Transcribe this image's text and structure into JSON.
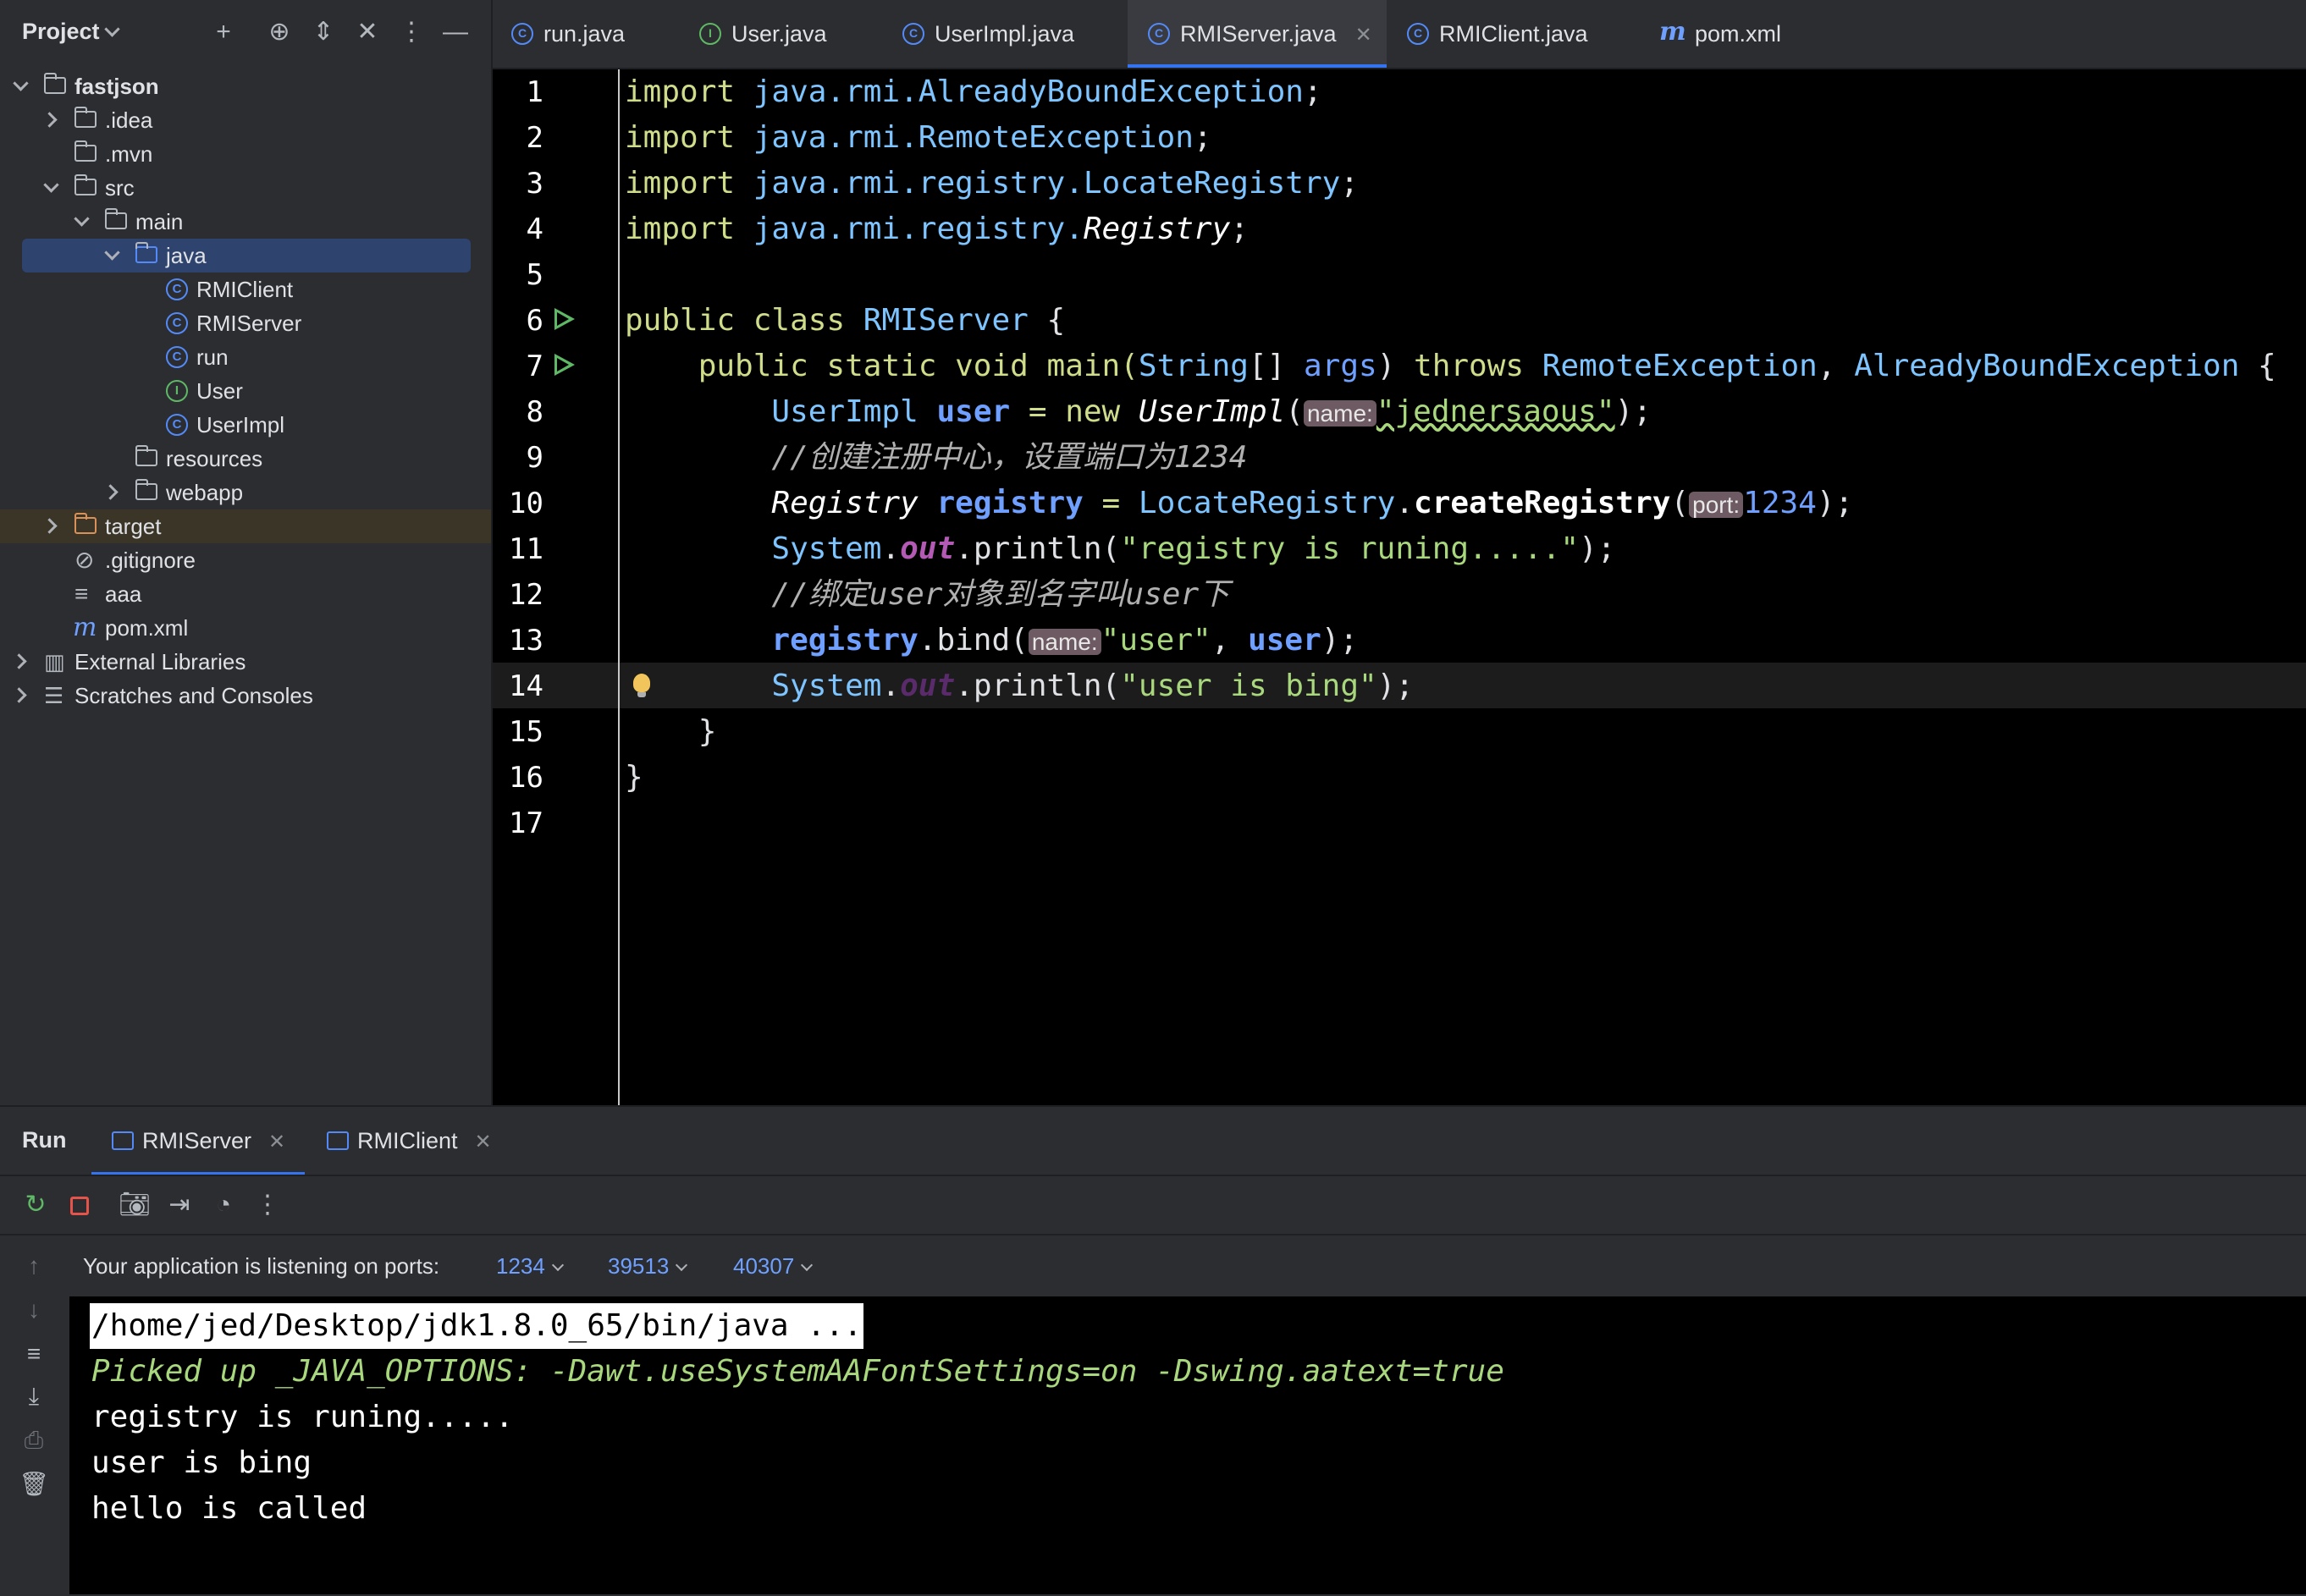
{
  "project": {
    "title": "Project",
    "tree": [
      {
        "label": "fastjson",
        "bold": true
      },
      {
        "label": ".idea"
      },
      {
        "label": ".mvn"
      },
      {
        "label": "src"
      },
      {
        "label": "main"
      },
      {
        "label": "java"
      },
      {
        "label": "RMIClient"
      },
      {
        "label": "RMIServer"
      },
      {
        "label": "run"
      },
      {
        "label": "User"
      },
      {
        "label": "UserImpl"
      },
      {
        "label": "resources"
      },
      {
        "label": "webapp"
      },
      {
        "label": "target"
      },
      {
        "label": ".gitignore"
      },
      {
        "label": "aaa"
      },
      {
        "label": "pom.xml"
      },
      {
        "label": "External Libraries"
      },
      {
        "label": "Scratches and Consoles"
      }
    ]
  },
  "tabs": [
    {
      "label": "run.java",
      "icon": "class-icon"
    },
    {
      "label": "User.java",
      "icon": "interface-icon"
    },
    {
      "label": "UserImpl.java",
      "icon": "class-icon"
    },
    {
      "label": "RMIServer.java",
      "icon": "class-icon",
      "active": true
    },
    {
      "label": "RMIClient.java",
      "icon": "class-icon"
    },
    {
      "label": "pom.xml",
      "icon": "maven-icon"
    }
  ],
  "editor": {
    "line_numbers": [
      "1",
      "2",
      "3",
      "4",
      "5",
      "6",
      "7",
      "8",
      "9",
      "10",
      "11",
      "12",
      "13",
      "14",
      "15",
      "16",
      "17"
    ],
    "tokens": {
      "import": "import",
      "l1_pkg": "java.rmi.AlreadyBoundException",
      "l2_pkg": "java.rmi.RemoteException",
      "l3_pkg": "java.rmi.registry.LocateRegistry",
      "l4_pkg": "java.rmi.registry.",
      "l4_cls": "Registry",
      "semi": ";",
      "public_class": "public class ",
      "RMIServer": "RMIServer",
      "brace_open": " {",
      "l7_kw": "public static void ",
      "main": "main(",
      "String": "String",
      "arr": "[] ",
      "args": "args",
      "close_paren": ") ",
      "throws": "throws ",
      "RemoteException": "RemoteException",
      "comma": ", ",
      "AlreadyBoundException": "AlreadyBoundException",
      "UserImpl": "UserImpl",
      "user": "user",
      "eq": " = ",
      "new": "new ",
      "UserImplCtor": "UserImpl",
      "lparen": "(",
      "hint_name": "name:",
      "str_jed": "\"jednersaous\"",
      "rparen_semi": ");",
      "comment1": "//创建注册中心，设置端口为1234",
      "Registry": "Registry",
      "registry": "registry",
      "LocateRegistry": "LocateRegistry",
      "createRegistry": "createRegistry",
      "hint_port": "port:",
      "num_port": "1234",
      "System": "System",
      "dot": ".",
      "out": "out",
      "println": ".println(",
      "str_reg": "\"registry is runing.....\"",
      "comment2": "//绑定user对象到名字叫user下",
      "bind": ".bind(",
      "str_user": "\"user\"",
      "str_bing": "\"user is bing\"",
      "brace_close": "}"
    }
  },
  "run": {
    "title": "Run",
    "tabs": [
      {
        "label": "RMIServer",
        "active": true
      },
      {
        "label": "RMIClient"
      }
    ],
    "ports_label": "Your application is listening on ports:",
    "ports": [
      "1234",
      "39513",
      "40307"
    ],
    "console": [
      "/home/jed/Desktop/jdk1.8.0_65/bin/java ...",
      "Picked up _JAVA_OPTIONS: -Dawt.useSystemAAFontSettings=on -Dswing.aatext=true",
      "registry is runing.....",
      "user is bing",
      "hello is called"
    ]
  }
}
